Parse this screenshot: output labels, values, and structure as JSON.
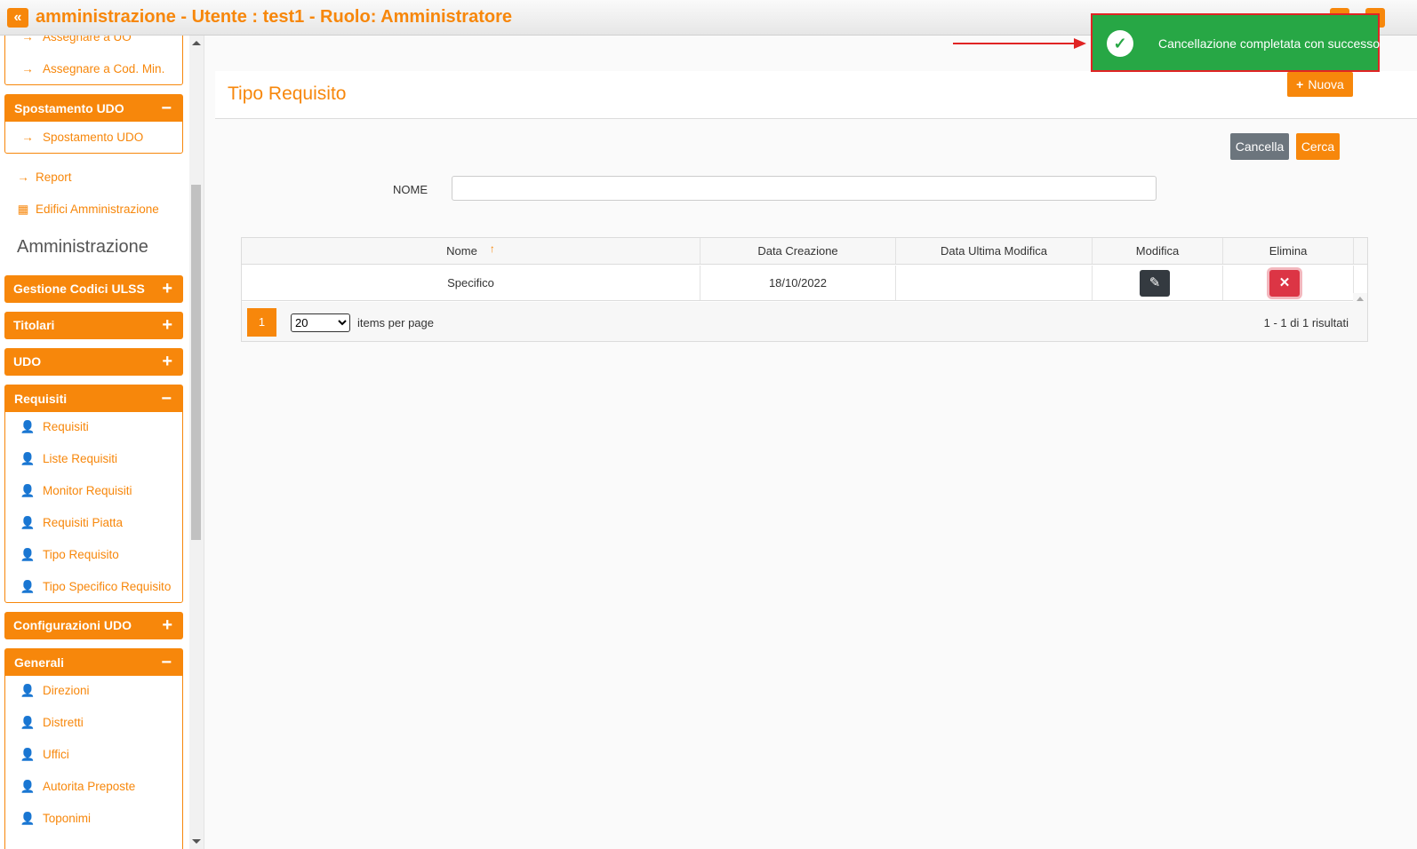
{
  "header": {
    "title": "amministrazione - Utente : test1 - Ruolo: Amministratore",
    "collapse_glyph": "«"
  },
  "sidebar": {
    "assign_items": [
      {
        "label": "Assegnare a UO",
        "icon": "arrow-right-icon"
      },
      {
        "label": "Assegnare a Cod. Min.",
        "icon": "arrow-right-icon"
      }
    ],
    "spostamento": {
      "title": "Spostamento UDO",
      "toggle": "−",
      "items": [
        {
          "label": "Spostamento UDO",
          "icon": "arrow-right-icon"
        }
      ]
    },
    "report_label": "Report",
    "edifici_label": "Edifici Amministrazione",
    "section_title": "Amministrazione",
    "gestione": {
      "title": "Gestione Codici ULSS",
      "toggle": "+"
    },
    "titolari": {
      "title": "Titolari",
      "toggle": "+"
    },
    "udo": {
      "title": "UDO",
      "toggle": "+"
    },
    "requisiti": {
      "title": "Requisiti",
      "toggle": "−",
      "items": [
        {
          "label": "Requisiti"
        },
        {
          "label": "Liste Requisiti"
        },
        {
          "label": "Monitor Requisiti"
        },
        {
          "label": "Requisiti Piatta"
        },
        {
          "label": "Tipo Requisito"
        },
        {
          "label": "Tipo Specifico Requisito"
        }
      ]
    },
    "configurazioni": {
      "title": "Configurazioni UDO",
      "toggle": "+"
    },
    "generali": {
      "title": "Generali",
      "toggle": "−",
      "items": [
        {
          "label": "Direzioni"
        },
        {
          "label": "Distretti"
        },
        {
          "label": "Uffici"
        },
        {
          "label": "Autorita Preposte"
        },
        {
          "label": "Toponimi"
        }
      ]
    }
  },
  "page": {
    "title": "Tipo Requisito",
    "new_label": "Nuova",
    "cancel_label": "Cancella",
    "search_label": "Cerca",
    "filter_label": "NOME",
    "filter_value": ""
  },
  "grid": {
    "columns": [
      "Nome",
      "Data Creazione",
      "Data Ultima Modifica",
      "Modifica",
      "Elimina"
    ],
    "rows": [
      {
        "nome": "Specifico",
        "data_creazione": "18/10/2022",
        "data_ultima_modifica": ""
      }
    ],
    "pager": {
      "current_page": "1",
      "page_size": "20",
      "items_per_page_label": "items per page",
      "results_text": "1 - 1 di 1 risultati"
    }
  },
  "toast": {
    "message": "Cancellazione completata con successo"
  },
  "colors": {
    "accent": "#f7870b",
    "success": "#27a745",
    "danger": "#dc3545",
    "dark": "#343a40",
    "secondary": "#6c757d"
  }
}
